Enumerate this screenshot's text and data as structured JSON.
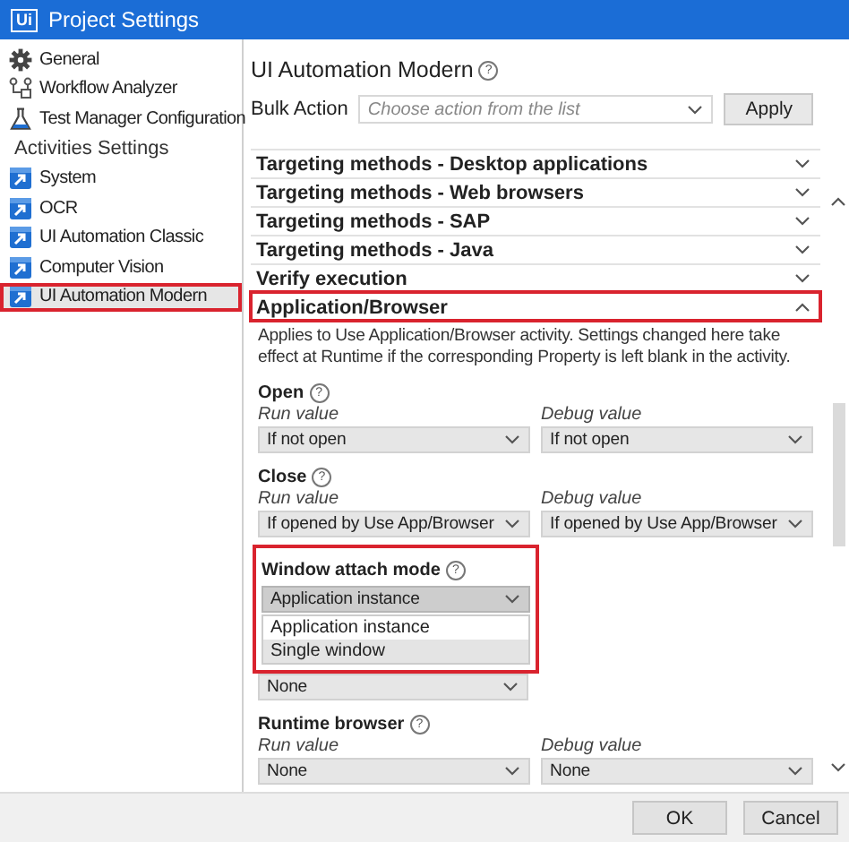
{
  "window": {
    "logo": "Ui",
    "title": "Project Settings"
  },
  "sidebar": {
    "items": [
      {
        "label": "General",
        "kind": "gear",
        "selected": false,
        "highlighted": false
      },
      {
        "label": "Workflow Analyzer",
        "kind": "flow",
        "selected": false,
        "highlighted": false
      },
      {
        "label": "Test Manager Configuration",
        "kind": "flask",
        "selected": false,
        "highlighted": false
      }
    ],
    "group": {
      "label": "Activities Settings",
      "items": [
        {
          "label": "System",
          "kind": "activity",
          "selected": false,
          "highlighted": false
        },
        {
          "label": "OCR",
          "kind": "activity",
          "selected": false,
          "highlighted": false
        },
        {
          "label": "UI Automation Classic",
          "kind": "activity",
          "selected": false,
          "highlighted": false
        },
        {
          "label": "Computer Vision",
          "kind": "activity",
          "selected": false,
          "highlighted": false
        },
        {
          "label": "UI Automation Modern",
          "kind": "activity",
          "selected": true,
          "highlighted": true
        }
      ]
    }
  },
  "main": {
    "title": "UI Automation Modern",
    "help": "?",
    "bulk_action": {
      "label": "Bulk Action",
      "placeholder": "Choose action from the list",
      "button": "Apply"
    },
    "sections": [
      {
        "title": "Targeting methods - Desktop applications",
        "expanded": false,
        "highlighted": false
      },
      {
        "title": "Targeting methods - Web browsers",
        "expanded": false,
        "highlighted": false
      },
      {
        "title": "Targeting methods - SAP",
        "expanded": false,
        "highlighted": false
      },
      {
        "title": "Targeting methods - Java",
        "expanded": false,
        "highlighted": false
      },
      {
        "title": "Verify execution",
        "expanded": false,
        "highlighted": false
      },
      {
        "title": "Application/Browser",
        "expanded": true,
        "highlighted": true,
        "description": "Applies to Use Application/Browser activity. Settings changed here take effect at Runtime if the corresponding Property is left blank in the activity.",
        "settings": [
          {
            "kind": "pair",
            "label": "Open",
            "help": "?",
            "run_label": "Run value",
            "run_value": "If not open",
            "debug_label": "Debug value",
            "debug_value": "If not open"
          },
          {
            "kind": "pair",
            "label": "Close",
            "help": "?",
            "run_label": "Run value",
            "run_value": "If opened by Use App/Browser",
            "debug_label": "Debug value",
            "debug_value": "If opened by Use App/Browser"
          },
          {
            "kind": "dropdown",
            "label": "Window attach mode",
            "help": "?",
            "value": "Application instance",
            "highlighted": true,
            "options": [
              {
                "label": "Application instance",
                "hovered": false
              },
              {
                "label": "Single window",
                "hovered": true
              }
            ]
          },
          {
            "kind": "covered",
            "value": "None"
          },
          {
            "kind": "pair",
            "label": "Runtime browser",
            "help": "?",
            "run_label": "Run value",
            "run_value": "None",
            "debug_label": "Debug value",
            "debug_value": "None"
          }
        ]
      }
    ]
  },
  "buttons": [
    "OK",
    "Cancel"
  ]
}
